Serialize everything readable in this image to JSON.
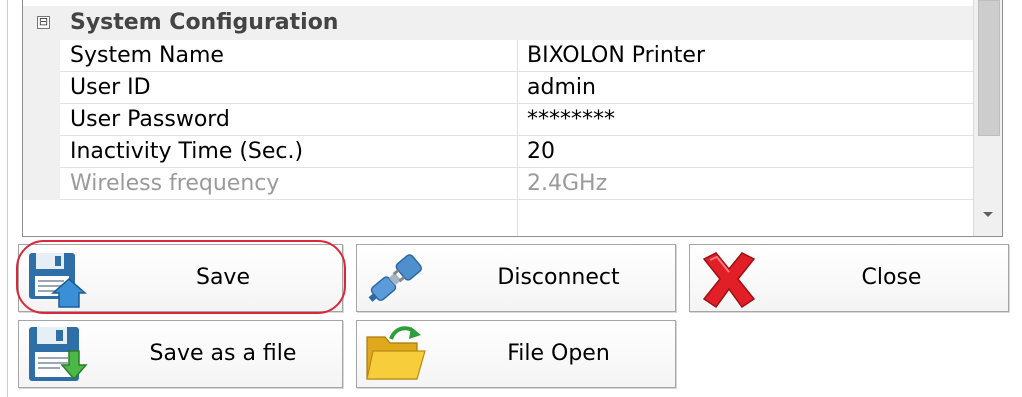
{
  "property_grid": {
    "category": {
      "expander": "⊟",
      "label": "System Configuration"
    },
    "rows": [
      {
        "name": "System Name",
        "value": "BIXOLON Printer",
        "enabled": true
      },
      {
        "name": "User ID",
        "value": "admin",
        "enabled": true
      },
      {
        "name": "User Password",
        "value": "********",
        "enabled": true
      },
      {
        "name": "Inactivity Time (Sec.)",
        "value": "20",
        "enabled": true
      },
      {
        "name": "Wireless frequency",
        "value": "2.4GHz",
        "enabled": false
      }
    ]
  },
  "buttons": {
    "save": {
      "label": "Save",
      "icon": "save-to-printer-icon",
      "highlighted": true,
      "highlight_color": "#d8283a"
    },
    "disconnect": {
      "label": "Disconnect",
      "icon": "plug-icon"
    },
    "close": {
      "label": "Close",
      "icon": "red-x-icon",
      "icon_color": "#e21f26"
    },
    "save_as_file": {
      "label": "Save as a file",
      "icon": "save-file-icon"
    },
    "file_open": {
      "label": "File Open",
      "icon": "folder-open-icon",
      "icon_color": "#f4c430"
    }
  }
}
